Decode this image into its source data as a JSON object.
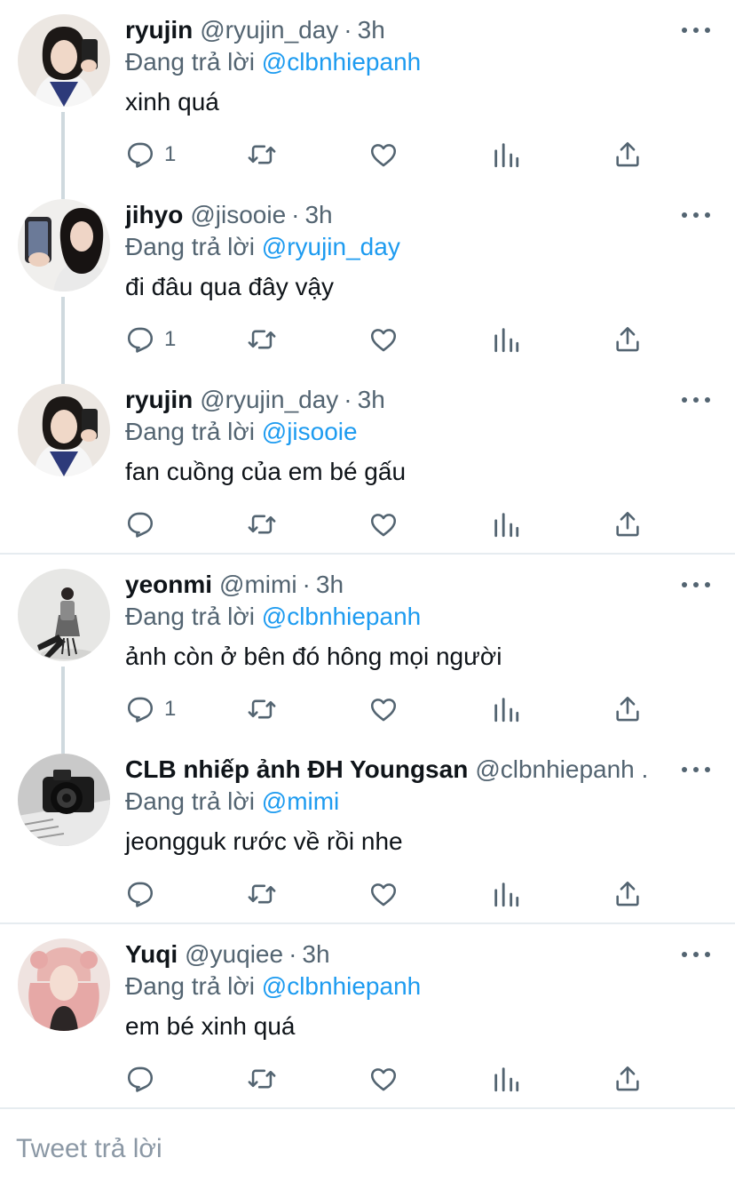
{
  "tweets": [
    {
      "name": "ryujin",
      "handle": "@ryujin_day",
      "dot": "·",
      "time": "3h",
      "reply_prefix": "Đang trả lời",
      "reply_to": "@clbnhiepanh",
      "text": "xinh quá",
      "reply_count": "1",
      "avatar": "girl-selfie-avatar"
    },
    {
      "name": "jihyo",
      "handle": "@jisooie",
      "dot": "·",
      "time": "3h",
      "reply_prefix": "Đang trả lời",
      "reply_to": "@ryujin_day",
      "text": "đi đâu qua đây vậy",
      "reply_count": "1",
      "avatar": "girl-phone-avatar"
    },
    {
      "name": "ryujin",
      "handle": "@ryujin_day",
      "dot": "·",
      "time": "3h",
      "reply_prefix": "Đang trả lời",
      "reply_to": "@jisooie",
      "text": "fan cuồng của em bé gấu",
      "reply_count": "",
      "avatar": "girl-selfie-avatar"
    },
    {
      "name": "yeonmi",
      "handle": "@mimi",
      "dot": "·",
      "time": "3h",
      "reply_prefix": "Đang trả lời",
      "reply_to": "@clbnhiepanh",
      "text": "ảnh còn ở bên đó hông mọi người",
      "reply_count": "1",
      "avatar": "girl-chair-avatar"
    },
    {
      "name": "CLB nhiếp ảnh ĐH Youngsan",
      "handle": "@clbnhiepanh ...",
      "dot": "",
      "time": "",
      "reply_prefix": "Đang trả lời",
      "reply_to": "@mimi",
      "text": "jeongguk rước về rồi nhe",
      "reply_count": "",
      "avatar": "camera-avatar"
    },
    {
      "name": "Yuqi",
      "handle": "@yuqiee",
      "dot": "·",
      "time": "3h",
      "reply_prefix": "Đang trả lời",
      "reply_to": "@clbnhiepanh",
      "text": "em bé xinh quá",
      "reply_count": "",
      "avatar": "pink-hair-avatar"
    }
  ],
  "compose": {
    "placeholder": "Tweet trả lời"
  },
  "colors": {
    "link": "#1d9bf0",
    "muted": "#536471",
    "text": "#0f1419",
    "divider": "#e6ecf0"
  }
}
